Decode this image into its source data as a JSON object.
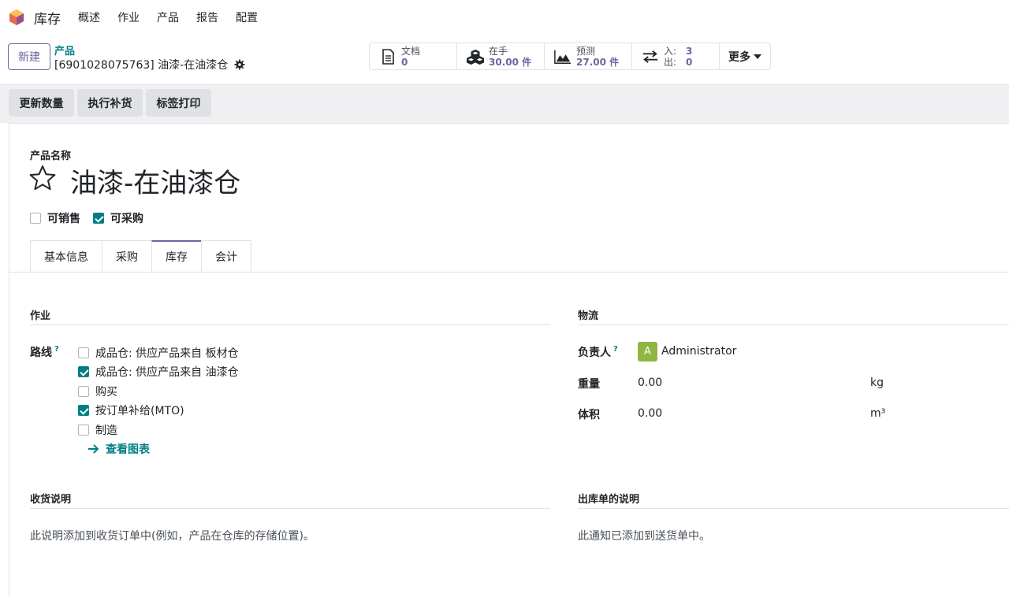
{
  "nav": {
    "app_title": "库存",
    "items": [
      "概述",
      "作业",
      "产品",
      "报告",
      "配置"
    ]
  },
  "control": {
    "new_label": "新建",
    "breadcrumb_parent": "产品",
    "breadcrumb_current": "[6901028075763] 油漆-在油漆仓",
    "smart": {
      "docs_label": "文档",
      "docs_value": "0",
      "onhand_label": "在手",
      "onhand_value": "30.00 件",
      "forecast_label": "预测",
      "forecast_value": "27.00 件",
      "in_label": "入:",
      "in_value": "3",
      "out_label": "出:",
      "out_value": "0",
      "more_label": "更多"
    }
  },
  "actions": [
    "更新数量",
    "执行补货",
    "标签打印"
  ],
  "sheet": {
    "name_label": "产品名称",
    "product_name": "油漆-在油漆仓",
    "sale_ok_label": "可销售",
    "purchase_ok_label": "可采购",
    "tabs": [
      "基本信息",
      "采购",
      "库存",
      "会计"
    ],
    "operations_title": "作业",
    "routes_label": "路线",
    "help_mark": "?",
    "routes": [
      {
        "label": "成品仓: 供应产品来自 板材仓",
        "checked": false
      },
      {
        "label": "成品仓: 供应产品来自 油漆仓",
        "checked": true
      },
      {
        "label": "购买",
        "checked": false
      },
      {
        "label": "按订单补给(MTO)",
        "checked": true
      },
      {
        "label": "制造",
        "checked": false
      }
    ],
    "view_diagram": "查看图表",
    "logistics_title": "物流",
    "responsible_label": "负责人",
    "responsible_avatar": "A",
    "responsible_value": "Administrator",
    "weight_label": "重量",
    "weight_value": "0.00",
    "weight_unit": "kg",
    "volume_label": "体积",
    "volume_value": "0.00",
    "volume_unit": "m³",
    "receipt_title": "收货说明",
    "receipt_note": "此说明添加到收货订单中(例如，产品在仓库的存储位置)。",
    "delivery_title": "出库单的说明",
    "delivery_note": "此通知已添加到送货单中。"
  },
  "colors": {
    "brand": "#71639e",
    "accent": "#017e84",
    "avatar": "#8db741"
  }
}
